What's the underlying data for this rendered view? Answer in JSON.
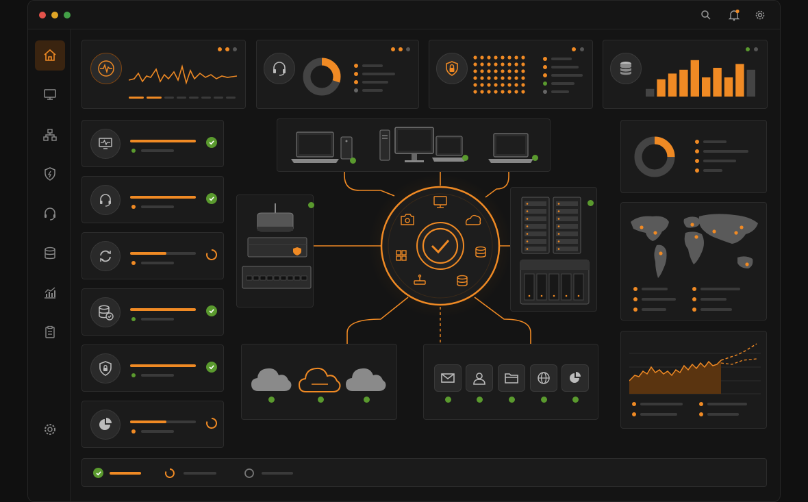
{
  "colors": {
    "accent": "#f08a24",
    "success": "#5a9a2e",
    "background": "#141414",
    "card": "#1b1b1b",
    "muted": "#3a3a3a"
  },
  "titlebar": {
    "controls": [
      "close",
      "minimize",
      "maximize"
    ],
    "actions": [
      "search-icon",
      "bell-icon",
      "gear-icon"
    ]
  },
  "sidebar": {
    "items": [
      {
        "icon": "home-icon",
        "active": true
      },
      {
        "icon": "monitor-icon"
      },
      {
        "icon": "network-icon"
      },
      {
        "icon": "shield-icon"
      },
      {
        "icon": "headset-icon"
      },
      {
        "icon": "database-icon"
      },
      {
        "icon": "analytics-icon"
      },
      {
        "icon": "clipboard-icon"
      },
      {
        "icon": "settings-icon"
      }
    ]
  },
  "status_list": [
    {
      "icon": "monitor-pulse-icon",
      "progress": 1.0,
      "status": "ok"
    },
    {
      "icon": "headset-icon",
      "progress": 1.0,
      "status": "ok"
    },
    {
      "icon": "sync-icon",
      "progress": 0.55,
      "status": "loading"
    },
    {
      "icon": "database-check-icon",
      "progress": 1.0,
      "status": "ok"
    },
    {
      "icon": "shield-lock-icon",
      "progress": 1.0,
      "status": "ok"
    },
    {
      "icon": "pie-chart-icon",
      "progress": 0.55,
      "status": "loading"
    }
  ],
  "top_widgets": [
    {
      "icon": "pulse-icon",
      "kind": "waveform"
    },
    {
      "icon": "headset-icon",
      "kind": "donut",
      "donut_fraction": 0.3
    },
    {
      "icon": "shield-lock-icon",
      "kind": "dot-matrix"
    },
    {
      "icon": "database-icon",
      "kind": "bar-chart",
      "bars": [
        0.2,
        0.45,
        0.6,
        0.7,
        0.95,
        0.5,
        0.75,
        0.5,
        0.85,
        0.7
      ]
    }
  ],
  "right_widgets": {
    "donut_fraction": 0.25,
    "map_markers": 9,
    "area_chart": "trend"
  },
  "topology": {
    "hub": {
      "icon": "check-icon"
    },
    "hub_ring_icons": [
      "monitor-icon",
      "cloud-icon",
      "database-icon",
      "database-icon",
      "router-icon",
      "grid-icon",
      "camera-icon"
    ],
    "clients": [
      "laptop",
      "desktop-tower",
      "monitor",
      "laptop",
      "laptop"
    ],
    "network_devices": [
      "router",
      "firewall",
      "switch"
    ],
    "servers": [
      "rack-server",
      "storage-array"
    ],
    "clouds": [
      "cloud",
      "cloud-active",
      "cloud"
    ],
    "services": [
      "mail-icon",
      "user-icon",
      "folder-icon",
      "globe-icon",
      "pie-chart-icon"
    ]
  },
  "footer": {
    "items": [
      {
        "status": "ok"
      },
      {
        "status": "loading"
      },
      {
        "status": "idle"
      }
    ]
  }
}
